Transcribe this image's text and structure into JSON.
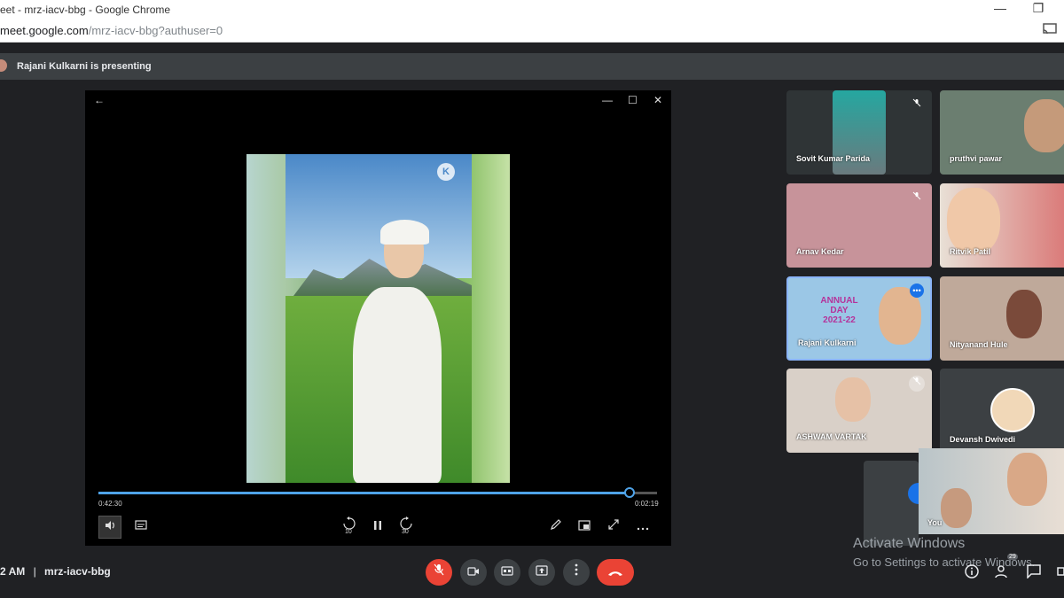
{
  "browser": {
    "window_title": "eet - mrz-iacv-bbg - Google Chrome",
    "url_host": "meet.google.com",
    "url_path": "/mrz-iacv-bbg?authuser=0",
    "minimize_glyph": "—",
    "restore_glyph": "❐"
  },
  "presentation": {
    "banner": "Rajani Kulkarni is presenting"
  },
  "player": {
    "progress": 0.95,
    "elapsed": "0:42:30",
    "remaining": "0:02:19",
    "rewind_label": "10",
    "forward_label": "30",
    "back_glyph": "←",
    "window_min_glyph": "—",
    "window_max_glyph": "☐",
    "window_close_glyph": "✕",
    "logo_text": "K"
  },
  "participants": [
    {
      "name": "Sovit Kumar Parida",
      "muted": true
    },
    {
      "name": "pruthvi pawar",
      "muted": false
    },
    {
      "name": "Arnav Kedar",
      "muted": true
    },
    {
      "name": "Ritvik Patil",
      "muted": false
    },
    {
      "name": "Rajani Kulkarni",
      "muted": false,
      "tile_text": [
        "ANNUAL",
        "DAY",
        "2021-22"
      ]
    },
    {
      "name": "Nityanand Hule",
      "muted": false
    },
    {
      "name": "ASHWAM VARTAK",
      "muted": true
    },
    {
      "name": "Devansh Dwivedi",
      "muted": false
    }
  ],
  "self_view": {
    "name": "You"
  },
  "meeting": {
    "time": "2 AM",
    "separator": "|",
    "code": "mrz-iacv-bbg",
    "participant_count": "29"
  },
  "watermark": {
    "title": "Activate Windows",
    "subtitle": "Go to Settings to activate Windows."
  },
  "icons": {
    "mic_off": "mic-off-icon",
    "camera": "camera-icon",
    "captions": "captions-icon",
    "present": "present-icon",
    "more": "more-vert-icon",
    "end_call": "end-call-icon",
    "info": "info-icon",
    "people": "people-icon",
    "chat": "chat-icon"
  },
  "colors": {
    "background": "#202124",
    "surface": "#3c4043",
    "danger": "#ea4335",
    "accent": "#4fa3e8",
    "more_button": "#1a73e8"
  }
}
